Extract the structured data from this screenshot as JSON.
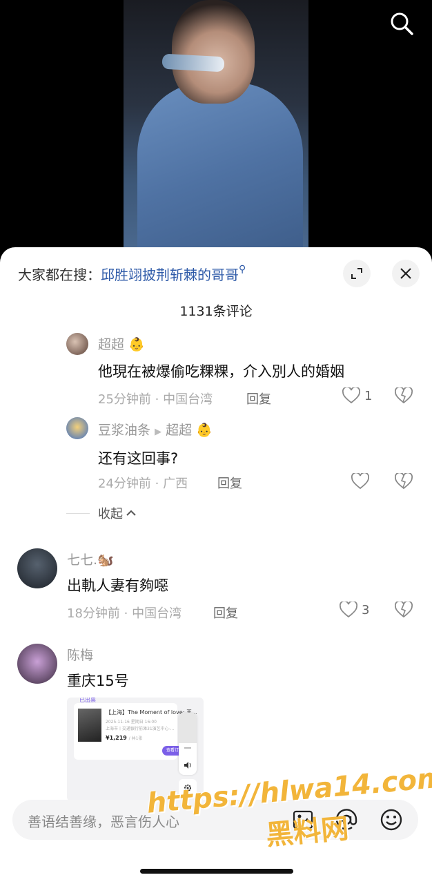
{
  "search_bar": {
    "prefix": "大家都在搜：",
    "query": "邱胜翊披荆斩棘的哥哥"
  },
  "comment_count": "1131条评论",
  "comments": [
    {
      "name": "超超",
      "emoji": "👶",
      "text": "他現在被爆偷吃粿粿，介入別人的婚姻",
      "meta": "25分钟前 · 中国台湾",
      "reply": "回复",
      "likes": "1"
    },
    {
      "name": "豆浆油条",
      "reply_to": "超超",
      "emoji": "👶",
      "text": "还有这回事?",
      "meta": "24分钟前 · 广西",
      "reply": "回复",
      "likes": ""
    },
    {
      "name": "七七.",
      "emoji": "🐿️",
      "text": "出軌人妻有夠噁",
      "meta": "18分钟前 · 中国台湾",
      "reply": "回复",
      "likes": "3"
    },
    {
      "name": "陈梅",
      "text": "重庆15号"
    }
  ],
  "collapse_label": "收起",
  "attachment": {
    "header": "已出票",
    "title": "【上海】The Moment of love: 王...",
    "date": "2025-11-16 星期日 16:00",
    "venue": "上海市丨交通银行前滩31演艺中心-...",
    "price": "¥1,219",
    "qty": "/ 共1张",
    "button": "查看订"
  },
  "input": {
    "placeholder": "善语结善缘，恶言伤人心"
  },
  "watermark": {
    "url": "https://hlwa14.com",
    "site": "黑料网"
  },
  "icons": {
    "search": "search-icon",
    "expand": "expand-icon",
    "close": "close-icon",
    "image": "image-icon",
    "at": "at-icon",
    "emoji": "emoji-icon"
  }
}
